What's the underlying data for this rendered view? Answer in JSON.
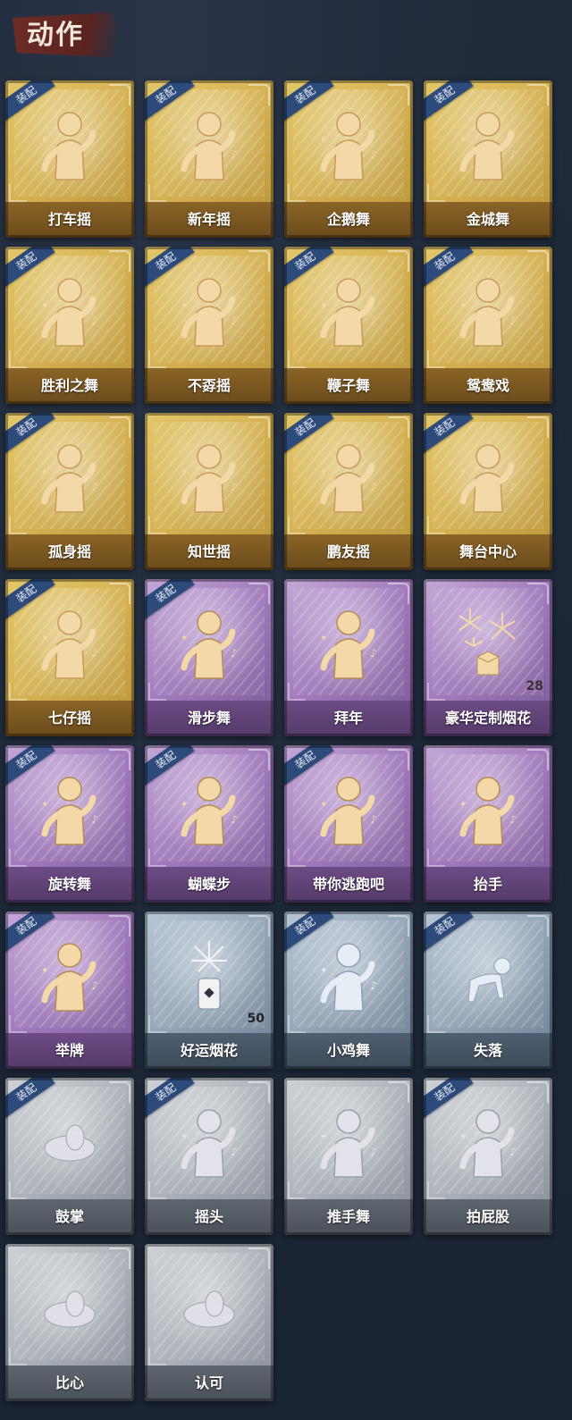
{
  "header": {
    "title": "动作"
  },
  "equip_label": "装配",
  "colors": {
    "gold": "#d8b657",
    "purple": "#a27cbc",
    "blue": "#93a4b6",
    "gray": "#aab0b8",
    "tag": "#2c4a7a",
    "title_banner": "#6e2d26"
  },
  "cards": [
    {
      "label": "打车摇",
      "tier": "gold",
      "equipped": true,
      "icon": "dance-figure-icon",
      "count": null
    },
    {
      "label": "新年摇",
      "tier": "gold",
      "equipped": true,
      "icon": "dance-figure-icon",
      "count": null
    },
    {
      "label": "企鹅舞",
      "tier": "gold",
      "equipped": true,
      "icon": "dance-figure-icon",
      "count": null
    },
    {
      "label": "金城舞",
      "tier": "gold",
      "equipped": true,
      "icon": "dance-figure-icon",
      "count": null
    },
    {
      "label": "胜利之舞",
      "tier": "gold",
      "equipped": true,
      "icon": "dance-figure-icon",
      "count": null
    },
    {
      "label": "不孬摇",
      "tier": "gold",
      "equipped": true,
      "icon": "dance-figure-icon",
      "count": null
    },
    {
      "label": "鞭子舞",
      "tier": "gold",
      "equipped": true,
      "icon": "dance-figure-icon",
      "count": null
    },
    {
      "label": "鸳鸯戏",
      "tier": "gold",
      "equipped": true,
      "icon": "dance-figure-icon",
      "count": null
    },
    {
      "label": "孤身摇",
      "tier": "gold",
      "equipped": true,
      "icon": "dance-figure-icon",
      "count": null
    },
    {
      "label": "知世摇",
      "tier": "gold",
      "equipped": false,
      "icon": "dance-figure-icon",
      "count": null
    },
    {
      "label": "鹏友摇",
      "tier": "gold",
      "equipped": true,
      "icon": "dance-figure-icon",
      "count": null
    },
    {
      "label": "舞台中心",
      "tier": "gold",
      "equipped": true,
      "icon": "dance-figure-icon",
      "count": null
    },
    {
      "label": "七仔摇",
      "tier": "gold",
      "equipped": true,
      "icon": "dance-figure-icon",
      "count": null
    },
    {
      "label": "滑步舞",
      "tier": "purple",
      "equipped": true,
      "icon": "dance-figure-icon",
      "count": null
    },
    {
      "label": "拜年",
      "tier": "purple",
      "equipped": false,
      "icon": "bow-figure-icon",
      "count": null
    },
    {
      "label": "豪华定制烟花",
      "tier": "purple",
      "equipped": false,
      "icon": "fireworks-box-icon",
      "count": "28"
    },
    {
      "label": "旋转舞",
      "tier": "purple",
      "equipped": true,
      "icon": "dance-figure-icon",
      "count": null
    },
    {
      "label": "蝴蝶步",
      "tier": "purple",
      "equipped": true,
      "icon": "dance-figure-icon",
      "count": null
    },
    {
      "label": "带你逃跑吧",
      "tier": "purple",
      "equipped": true,
      "icon": "dance-figure-icon",
      "count": null
    },
    {
      "label": "抬手",
      "tier": "purple",
      "equipped": false,
      "icon": "raise-hand-figure-icon",
      "count": null
    },
    {
      "label": "举牌",
      "tier": "purple",
      "equipped": true,
      "icon": "sign-figure-icon",
      "count": null
    },
    {
      "label": "好运烟花",
      "tier": "blue",
      "equipped": false,
      "icon": "firework-can-icon",
      "count": "50"
    },
    {
      "label": "小鸡舞",
      "tier": "blue",
      "equipped": true,
      "icon": "chicken-figure-icon",
      "count": null
    },
    {
      "label": "失落",
      "tier": "blue",
      "equipped": true,
      "icon": "crawl-figure-icon",
      "count": null
    },
    {
      "label": "鼓掌",
      "tier": "gray",
      "equipped": true,
      "icon": "clap-hands-icon",
      "count": null
    },
    {
      "label": "摇头",
      "tier": "gray",
      "equipped": true,
      "icon": "shake-figure-icon",
      "count": null
    },
    {
      "label": "推手舞",
      "tier": "gray",
      "equipped": false,
      "icon": "push-figure-icon",
      "count": null
    },
    {
      "label": "拍屁股",
      "tier": "gray",
      "equipped": true,
      "icon": "slap-figure-icon",
      "count": null
    },
    {
      "label": "比心",
      "tier": "gray",
      "equipped": false,
      "icon": "heart-hand-icon",
      "count": null
    },
    {
      "label": "认可",
      "tier": "gray",
      "equipped": false,
      "icon": "thumbs-up-icon",
      "count": null
    }
  ]
}
